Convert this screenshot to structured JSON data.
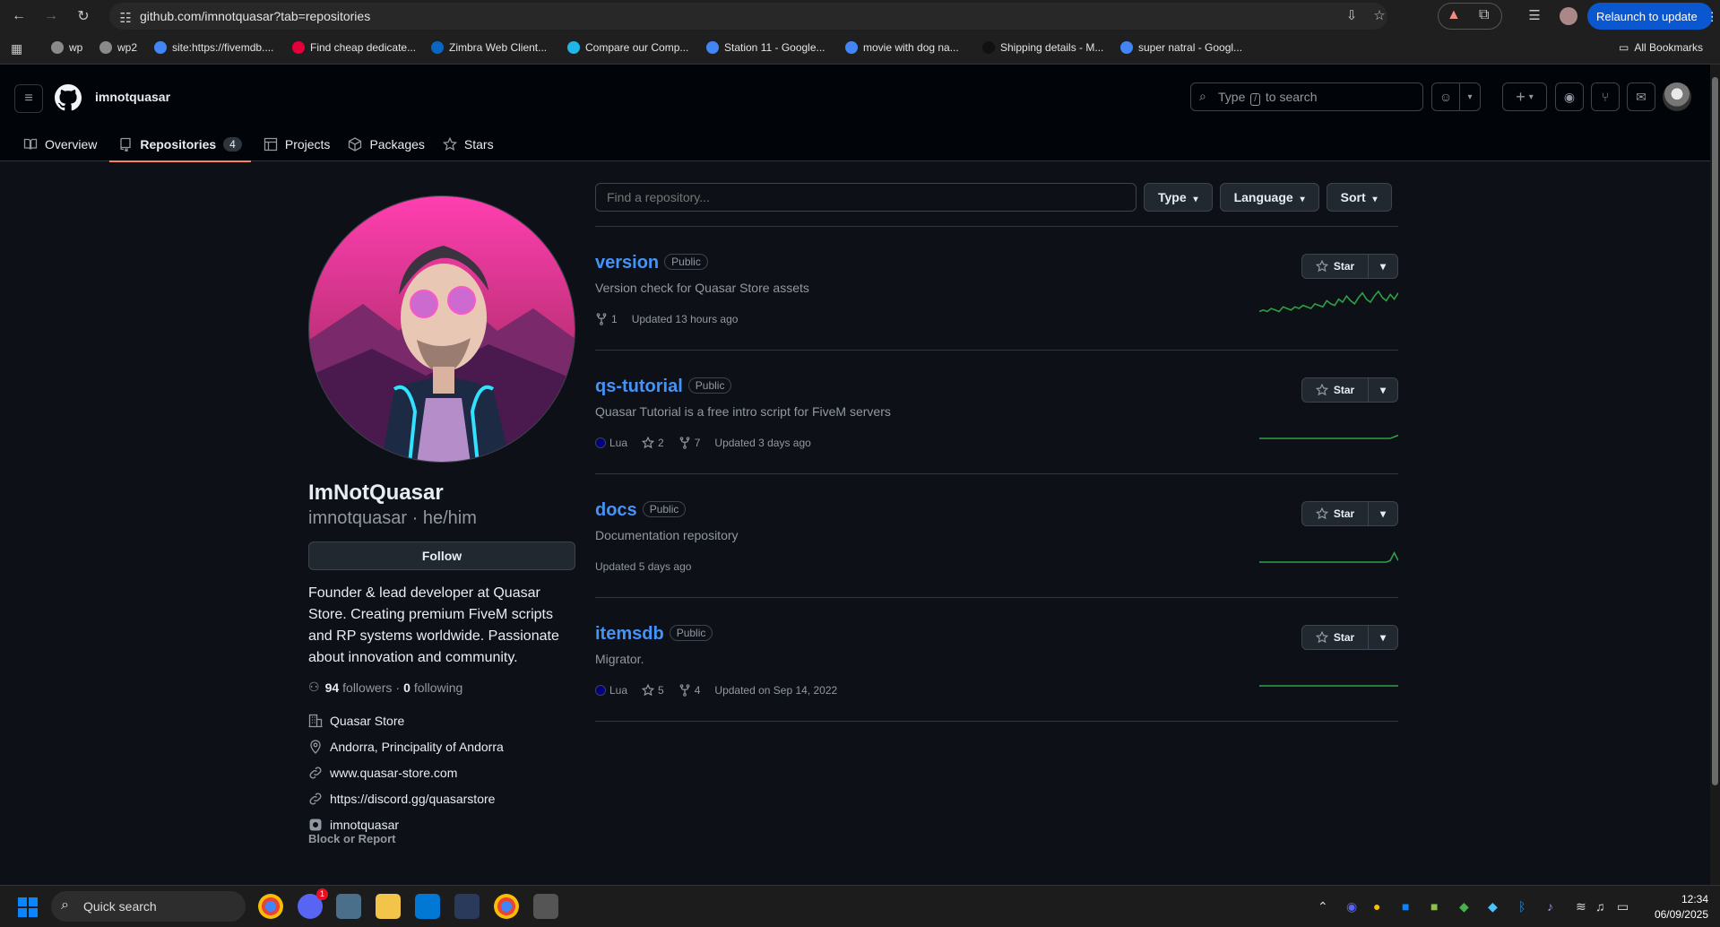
{
  "browser": {
    "url": "github.com/imnotquasar?tab=repositories",
    "relaunch_label": "Relaunch to update",
    "all_bookmarks": "All Bookmarks",
    "bookmarks": [
      {
        "label": "wp",
        "color": "#8a8a8a"
      },
      {
        "label": "wp2",
        "color": "#8a8a8a"
      },
      {
        "label": "site:https://fivemdb....",
        "color": "#4285f4"
      },
      {
        "label": "Find cheap dedicate...",
        "color": "#e4003a"
      },
      {
        "label": "Zimbra Web Client...",
        "color": "#0a66c2"
      },
      {
        "label": "Compare our Comp...",
        "color": "#1fb6e8"
      },
      {
        "label": "Station 11 - Google...",
        "color": "#4285f4"
      },
      {
        "label": "movie with dog na...",
        "color": "#4285f4"
      },
      {
        "label": "Shipping details - M...",
        "color": "#111111"
      },
      {
        "label": "super natral - Googl...",
        "color": "#4285f4"
      }
    ]
  },
  "header": {
    "username": "imnotquasar",
    "search_prefix": "Type",
    "search_key": "/",
    "search_suffix": "to search"
  },
  "tabs": [
    {
      "label": "Overview",
      "icon": "book-icon",
      "active": false
    },
    {
      "label": "Repositories",
      "icon": "repo-icon",
      "count": "4",
      "active": true
    },
    {
      "label": "Projects",
      "icon": "table-icon",
      "active": false
    },
    {
      "label": "Packages",
      "icon": "package-icon",
      "active": false
    },
    {
      "label": "Stars",
      "icon": "star-icon",
      "active": false
    }
  ],
  "profile": {
    "name": "ImNotQuasar",
    "login": "imnotquasar · he/him",
    "follow_label": "Follow",
    "bio": "Founder & lead developer at Quasar Store. Creating premium FiveM scripts and RP systems worldwide. Passionate about innovation and community.",
    "followers_count": "94",
    "followers_label": "followers",
    "following_count": "0",
    "following_label": "following",
    "separator": "·",
    "company": "Quasar Store",
    "location": "Andorra, Principality of Andorra",
    "website": "www.quasar-store.com",
    "discord": "https://discord.gg/quasarstore",
    "instagram": "imnotquasar",
    "block_label": "Block or Report"
  },
  "filters": {
    "search_placeholder": "Find a repository...",
    "type_label": "Type",
    "language_label": "Language",
    "sort_label": "Sort"
  },
  "star_label": "Star",
  "repos": [
    {
      "name": "version",
      "visibility": "Public",
      "description": "Version check for Quasar Store assets",
      "language": "",
      "stars": "",
      "forks": "1",
      "updated": "Updated 13 hours ago",
      "activity": [
        2,
        3,
        2,
        4,
        3,
        2,
        5,
        4,
        3,
        5,
        4,
        6,
        5,
        4,
        7,
        6,
        5,
        9,
        7,
        6,
        10,
        8,
        12,
        9,
        7,
        11,
        14,
        10,
        8,
        12,
        15,
        11,
        9,
        13,
        10,
        14
      ]
    },
    {
      "name": "qs-tutorial",
      "visibility": "Public",
      "description": "Quasar Tutorial is a free intro script for FiveM servers",
      "language": "Lua",
      "stars": "2",
      "forks": "7",
      "updated": "Updated 3 days ago",
      "activity": [
        0,
        0,
        0,
        0,
        0,
        0,
        0,
        0,
        0,
        0,
        0,
        0,
        0,
        0,
        0,
        0,
        0,
        0,
        0,
        0,
        0,
        0,
        0,
        0,
        0,
        0,
        0,
        0,
        0,
        0,
        0,
        0,
        0,
        0,
        1,
        2
      ]
    },
    {
      "name": "docs",
      "visibility": "Public",
      "description": "Documentation repository",
      "language": "",
      "stars": "",
      "forks": "",
      "updated": "Updated 5 days ago",
      "activity": [
        0,
        0,
        0,
        0,
        0,
        0,
        0,
        0,
        0,
        0,
        0,
        0,
        0,
        0,
        0,
        0,
        0,
        0,
        0,
        0,
        0,
        0,
        0,
        0,
        0,
        0,
        0,
        0,
        0,
        0,
        0,
        0,
        0,
        1,
        6,
        1
      ]
    },
    {
      "name": "itemsdb",
      "visibility": "Public",
      "description": "Migrator.",
      "language": "Lua",
      "stars": "5",
      "forks": "4",
      "updated": "Updated on Sep 14, 2022",
      "activity": [
        0,
        0,
        0,
        0,
        0,
        0,
        0,
        0,
        0,
        0,
        0,
        0,
        0,
        0,
        0,
        0,
        0,
        0,
        0,
        0,
        0,
        0,
        0,
        0,
        0,
        0,
        0,
        0,
        0,
        0,
        0,
        0,
        0,
        0,
        0,
        0
      ]
    }
  ],
  "taskbar": {
    "quick_search": "Quick search",
    "time": "12:34",
    "date": "06/09/2025",
    "discord_badge": "1"
  },
  "colors": {
    "accent": "#f78166",
    "link": "#4493f8",
    "spark": "#2ea043",
    "lua": "#000080"
  }
}
